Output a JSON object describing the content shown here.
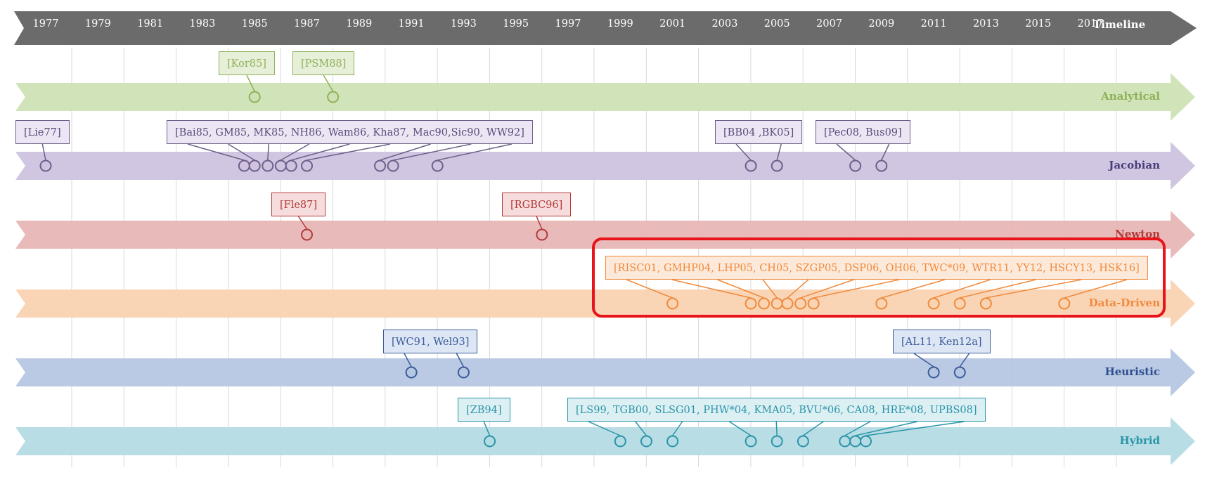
{
  "timeline": {
    "label": "Timeline",
    "years": [
      "1977",
      "1979",
      "1981",
      "1983",
      "1985",
      "1987",
      "1989",
      "1991",
      "1993",
      "1995",
      "1997",
      "1999",
      "2001",
      "2003",
      "2005",
      "2007",
      "2009",
      "2011",
      "2013",
      "2015",
      "2017"
    ]
  },
  "bands": [
    {
      "id": "analytical",
      "label": "Analytical",
      "fill": "#cfe1b4",
      "stroke": "#8fb158",
      "text": "#8fb158",
      "boxes": [
        {
          "text": "[Kor85]",
          "fill": "#e6efd8",
          "stroke": "#8fb158",
          "text_color": "#8fb158",
          "years": [
            1985.0
          ]
        },
        {
          "text": "[PSM88]",
          "fill": "#e6efd8",
          "stroke": "#8fb158",
          "text_color": "#8fb158",
          "years": [
            1988.0
          ]
        }
      ]
    },
    {
      "id": "jacobian",
      "label": "Jacobian",
      "fill": "#cfc3df",
      "stroke": "#6e5f8a",
      "text": "#4a3f7a",
      "boxes": [
        {
          "text": "[Lie77]",
          "fill": "#ece6f4",
          "stroke": "#6e5f8a",
          "text_color": "#5a4d7a",
          "years": [
            1977.0
          ]
        },
        {
          "text": "[Bai85, GM85, MK85, NH86, Wam86, Kha87, Mac90,Sic90, WW92]",
          "fill": "#ece6f4",
          "stroke": "#6e5f8a",
          "text_color": "#5a4d7a",
          "years": [
            1984.6,
            1985.0,
            1985.5,
            1986.0,
            1986.4,
            1987.0,
            1989.8,
            1990.3,
            1992.0
          ]
        },
        {
          "text": "[BB04 ,BK05]",
          "fill": "#ece6f4",
          "stroke": "#6e5f8a",
          "text_color": "#5a4d7a",
          "years": [
            2004.0,
            2005.0
          ]
        },
        {
          "text": "[Pec08, Bus09]",
          "fill": "#ece6f4",
          "stroke": "#6e5f8a",
          "text_color": "#5a4d7a",
          "years": [
            2008.0,
            2009.0
          ]
        }
      ]
    },
    {
      "id": "newton",
      "label": "Newton",
      "fill": "#e8b6b6",
      "stroke": "#b23a3a",
      "text": "#b23a3a",
      "boxes": [
        {
          "text": "[Fle87]",
          "fill": "#f6dcdc",
          "stroke": "#b23a3a",
          "text_color": "#b23a3a",
          "years": [
            1987.0
          ]
        },
        {
          "text": "[RGBC96]",
          "fill": "#f6dcdc",
          "stroke": "#b23a3a",
          "text_color": "#b23a3a",
          "years": [
            1996.0
          ]
        }
      ]
    },
    {
      "id": "data-driven",
      "label": "Data-Driven",
      "fill": "#f9d3b2",
      "stroke": "#f08a3c",
      "text": "#f08a3c",
      "boxes": [
        {
          "text": "[RISC01, GMHP04, LHP05, CH05, SZGP05, DSP06, OH06, TWC*09, WTR11, YY12, HSCY13, HSK16]",
          "fill": "#fde9d9",
          "stroke": "#f08a3c",
          "text_color": "#f08a3c",
          "years": [
            2001.0,
            2004.0,
            2004.5,
            2005.0,
            2005.4,
            2005.9,
            2006.4,
            2009.0,
            2011.0,
            2012.0,
            2013.0,
            2016.0
          ]
        }
      ]
    },
    {
      "id": "heuristic",
      "label": "Heuristic",
      "fill": "#b6c7e3",
      "stroke": "#3b5b9a",
      "text": "#2e4e8e",
      "boxes": [
        {
          "text": "[WC91, Wel93]",
          "fill": "#dce6f4",
          "stroke": "#3b5b9a",
          "text_color": "#3b5b9a",
          "years": [
            1991.0,
            1993.0
          ]
        },
        {
          "text": "[AL11, Ken12a]",
          "fill": "#dce6f4",
          "stroke": "#3b5b9a",
          "text_color": "#3b5b9a",
          "years": [
            2011.0,
            2012.0
          ]
        }
      ]
    },
    {
      "id": "hybrid",
      "label": "Hybrid",
      "fill": "#b5dbe4",
      "stroke": "#2a95a8",
      "text": "#2a95a8",
      "boxes": [
        {
          "text": "[ZB94]",
          "fill": "#dceff3",
          "stroke": "#2a95a8",
          "text_color": "#2a95a8",
          "years": [
            1994.0
          ]
        },
        {
          "text": "[LS99, TGB00, SLSG01, PHW*04, KMA05, BVU*06, CA08, HRE*08, UPBS08]",
          "fill": "#dceff3",
          "stroke": "#2a95a8",
          "text_color": "#2a95a8",
          "years": [
            1999.0,
            2000.0,
            2001.0,
            2004.0,
            2005.0,
            2006.0,
            2007.6,
            2008.0,
            2008.4
          ]
        }
      ]
    }
  ],
  "colors": {
    "timeline_arrow": "#6b6b6b",
    "highlight": "#e8141a",
    "grid": "#d9d9d9"
  }
}
